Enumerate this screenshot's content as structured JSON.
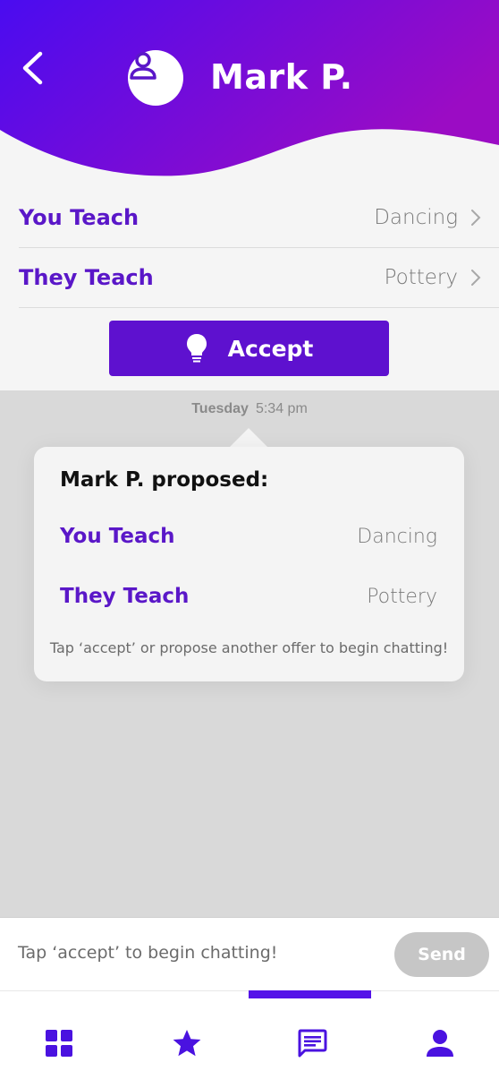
{
  "colors": {
    "gradient_start": "#4a0cf0",
    "gradient_end": "#9b0cc4",
    "accent_purple": "#5a17c8",
    "accept_button": "#5e11cf",
    "tab_icon": "#4a12e0"
  },
  "header": {
    "back_icon": "chevron-left-icon",
    "avatar_icon": "user-icon",
    "name": "Mark P."
  },
  "offer": {
    "rows": [
      {
        "label": "You Teach",
        "value": "Dancing"
      },
      {
        "label": "They Teach",
        "value": "Pottery"
      }
    ],
    "accept_label": "Accept",
    "accept_icon": "lightbulb-icon"
  },
  "message": {
    "day": "Tuesday",
    "time": "5:34 pm",
    "title": "Mark P. proposed:",
    "rows": [
      {
        "label": "You Teach",
        "value": "Dancing"
      },
      {
        "label": "They Teach",
        "value": "Pottery"
      }
    ],
    "hint": "Tap ‘accept’ or propose another offer to begin chatting!"
  },
  "composer": {
    "placeholder": "Tap ‘accept’ to begin chatting!",
    "send_label": "Send"
  },
  "tabbar": {
    "items": [
      "grid-icon",
      "star-icon",
      "chat-icon",
      "profile-icon"
    ],
    "active_index": 2
  }
}
